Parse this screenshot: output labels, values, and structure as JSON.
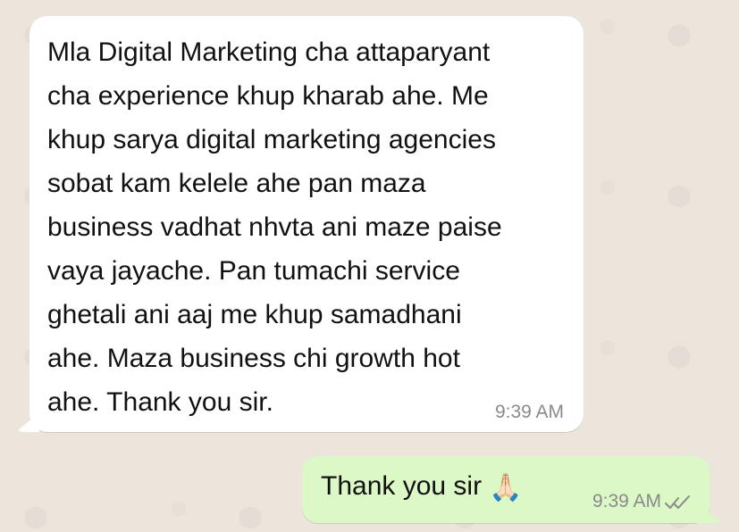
{
  "chat": {
    "messages": [
      {
        "direction": "incoming",
        "text": "Mla Digital Marketing cha attaparyant\ncha experience khup kharab ahe. Me\nkhup sarya digital marketing agencies\nsobat kam kelele ahe pan maza\nbusiness vadhat nhvta ani maze paise\nvaya jayache. Pan tumachi service\nghetali ani aaj me khup samadhani\nahe. Maza business chi growth hot\nahe. Thank you sir.",
        "time": "9:39 AM"
      },
      {
        "direction": "outgoing",
        "text": "Thank you sir",
        "emoji": "🙏🏻",
        "time": "9:39 AM",
        "status_icon": "double-check-icon"
      }
    ]
  },
  "colors": {
    "background": "#ece5dc",
    "incoming_bubble": "#ffffff",
    "outgoing_bubble": "#dcf8c6",
    "timestamp": "#8a8a8a",
    "check_gray": "#8a8a8a"
  }
}
